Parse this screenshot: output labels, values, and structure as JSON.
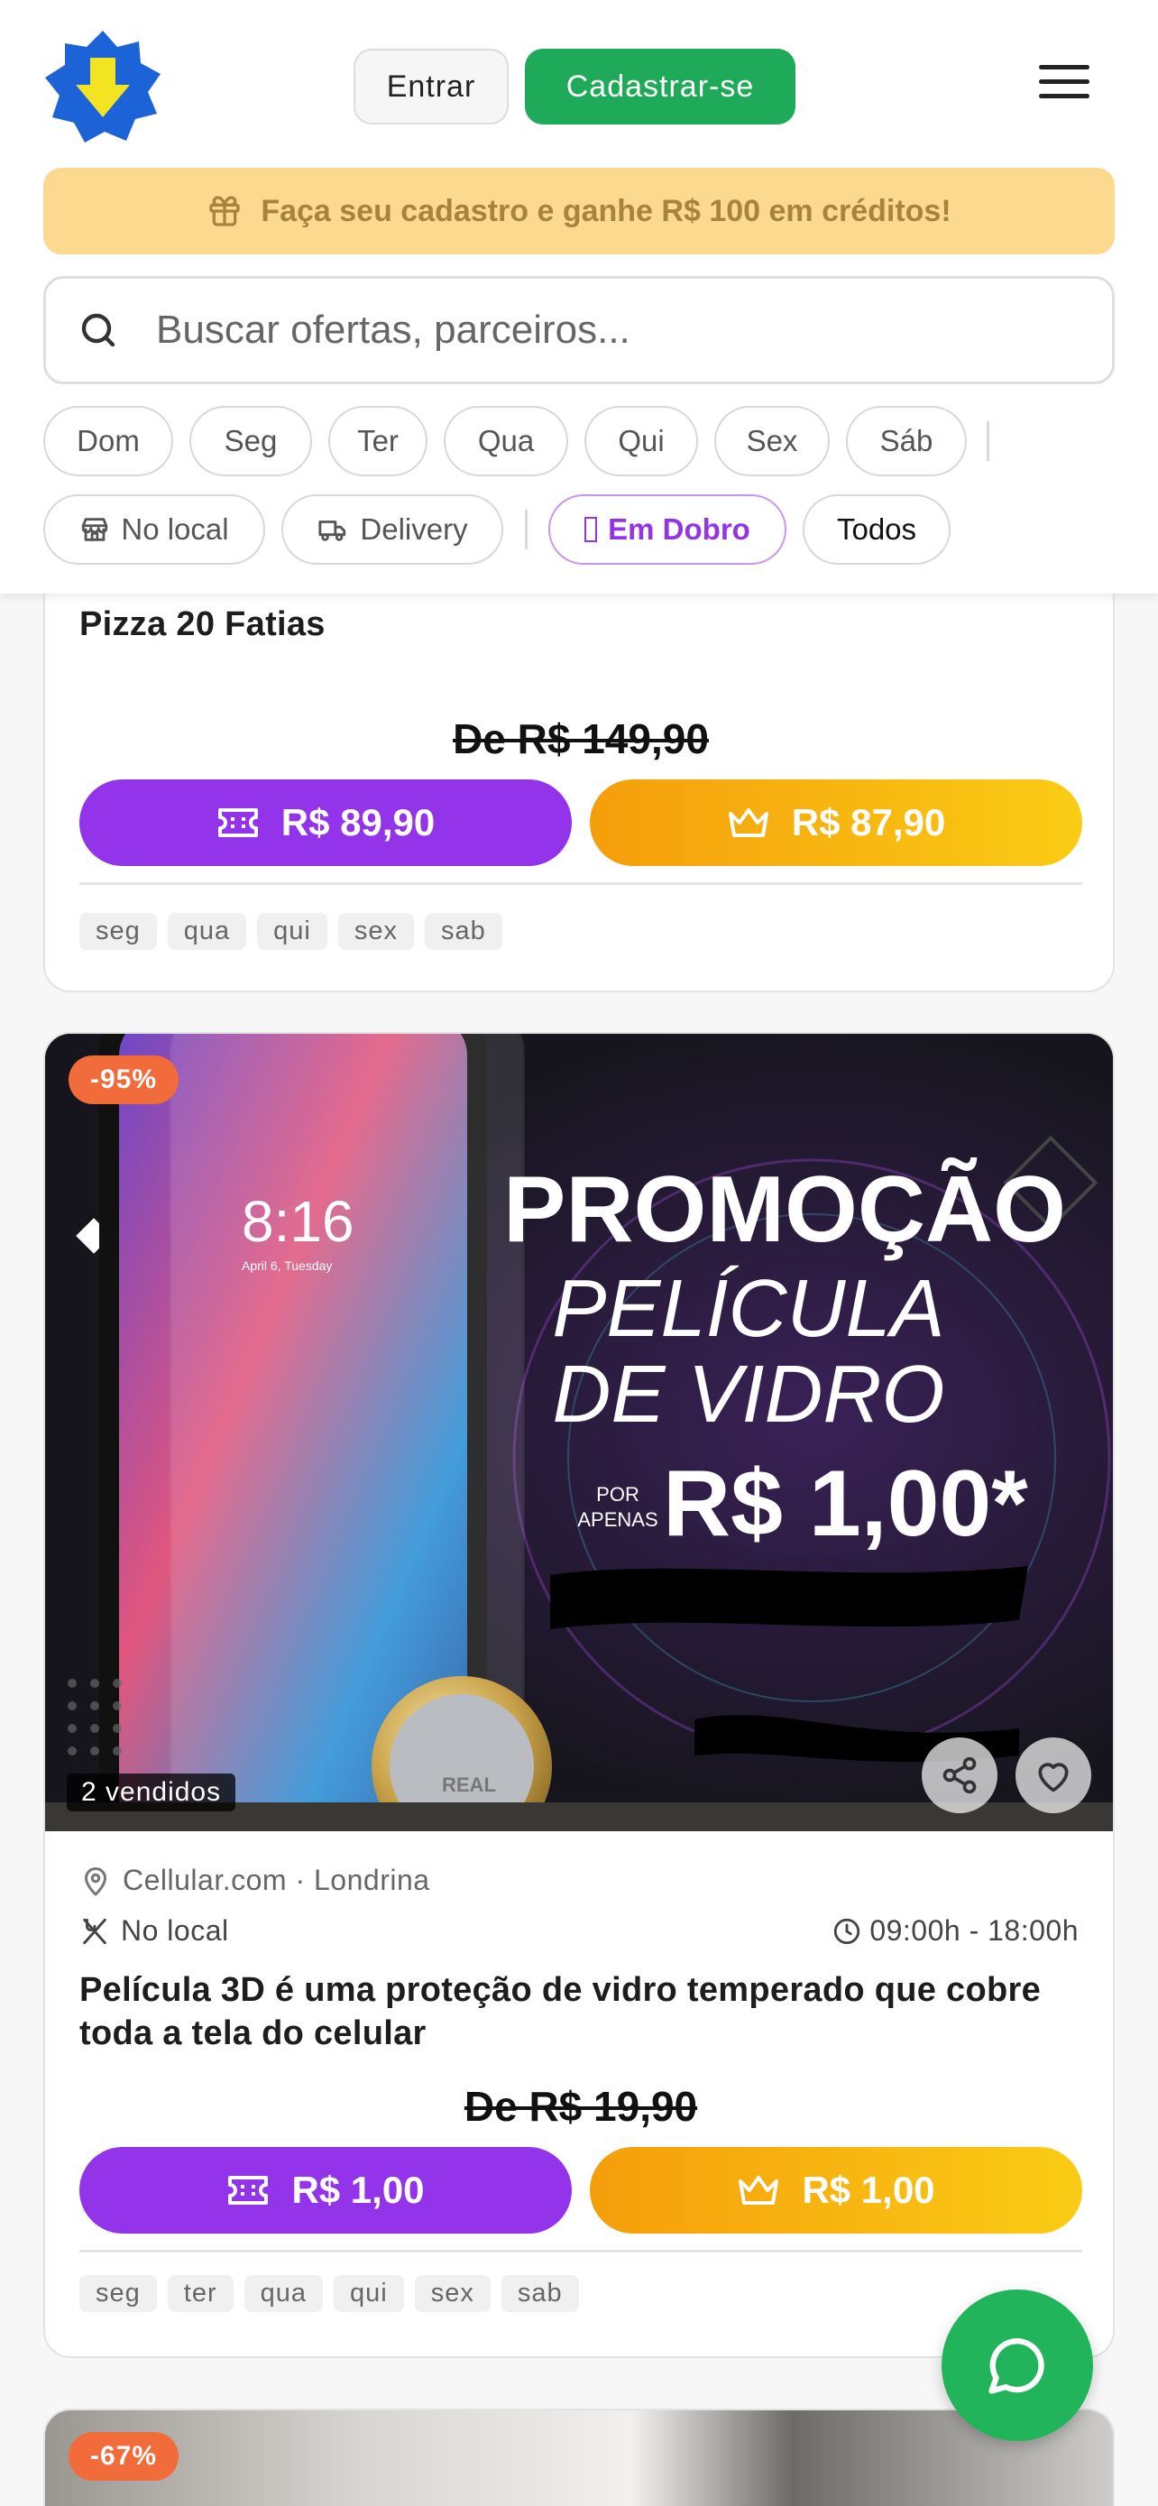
{
  "header": {
    "login_label": "Entrar",
    "signup_label": "Cadastrar-se",
    "promo_text": "Faça seu cadastro e ganhe R$ 100 em créditos!"
  },
  "search": {
    "placeholder": "Buscar ofertas, parceiros..."
  },
  "day_filters": [
    "Dom",
    "Seg",
    "Ter",
    "Qua",
    "Qui",
    "Sex",
    "Sáb"
  ],
  "type_filters": {
    "local": "No local",
    "delivery": "Delivery",
    "double": "Em Dobro",
    "all": "Todos"
  },
  "cards": [
    {
      "title": "Pizza 20 Fatias",
      "old_price": "De R$ 149,90",
      "price": "R$ 89,90",
      "premium_price": "R$ 87,90",
      "days": [
        "seg",
        "qua",
        "qui",
        "sex",
        "sab"
      ]
    },
    {
      "discount": "-95%",
      "sold": "2 vendidos",
      "image_text": {
        "line1": "PROMOÇÃO",
        "line2": "PELÍCULA",
        "line3": "DE VIDRO",
        "por": "POR",
        "apenas": "APENAS",
        "price": "R$ 1,00*",
        "phone_time": "8:16",
        "phone_date": "April 6, Tuesday",
        "coin": "REAL"
      },
      "partner": "Cellular.com · Londrina",
      "mode": "No local",
      "hours": "09:00h - 18:00h",
      "title": "Película 3D é uma proteção de vidro temperado que cobre toda a tela do celular",
      "old_price": "De R$ 19,90",
      "price": "R$ 1,00",
      "premium_price": "R$ 1,00",
      "days": [
        "seg",
        "ter",
        "qua",
        "qui",
        "sex",
        "sab"
      ]
    },
    {
      "discount": "-67%"
    }
  ],
  "colors": {
    "brand_green": "#1faa59",
    "purple": "#9333ea",
    "gold": "#f59e0b",
    "discount_orange": "#f26b3a",
    "promo_bg": "#fbd98e"
  }
}
